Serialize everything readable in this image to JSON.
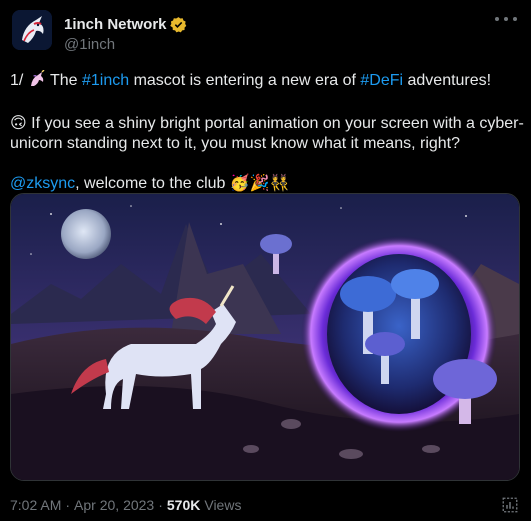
{
  "author": {
    "display_name": "1inch Network",
    "handle": "@1inch"
  },
  "tweet": {
    "line1_prefix": "1/ ",
    "line1_the": " The ",
    "line1_tag1": "#1inch",
    "line1_mid": " mascot is entering a new era of ",
    "line1_tag2": "#DeFi",
    "line1_suffix": " adventures!",
    "line2_emoji": "🙃",
    "line2_text": " If you see a shiny bright portal animation on your screen with a cyber-unicorn standing next to it, you must know what it means, right?",
    "line3_mention": "@zksync",
    "line3_text": ", welcome to the club ",
    "line3_emojis": "🥳🎉👯"
  },
  "meta": {
    "time": "7:02 AM",
    "dot": "·",
    "date": "Apr 20, 2023",
    "views_count": "570K",
    "views_label": "Views"
  },
  "icons": {
    "verified": "verified-badge-icon",
    "more": "more-options-icon",
    "analytics": "analytics-icon",
    "unicorn": "unicorn-emoji-icon"
  },
  "colors": {
    "background": "#000000",
    "text": "#e7e9ea",
    "secondary": "#71767b",
    "link": "#1d9bf0",
    "verified": "#e8b92d"
  }
}
